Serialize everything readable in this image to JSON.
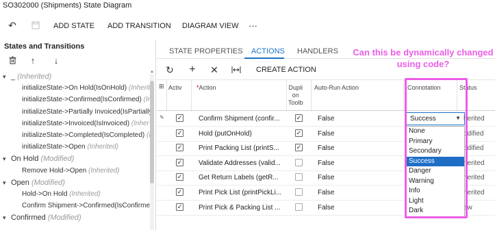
{
  "window": {
    "title": "SO302000 (Shipments) State Diagram"
  },
  "toolbar": {
    "undo_icon": "undo-icon",
    "save_icon": "save-icon",
    "add_state": "ADD STATE",
    "add_transition": "ADD TRANSITION",
    "diagram_view": "DIAGRAM VIEW",
    "more": "···"
  },
  "left": {
    "title": "States and Transitions",
    "tree": [
      {
        "kind": "root",
        "caret": "▾",
        "name": "_",
        "tag": "(Inherited)"
      },
      {
        "kind": "child",
        "name": "initializeState->On Hold(IsOnHold)",
        "tag": "(Inherit"
      },
      {
        "kind": "child",
        "name": "initializeState->Confirmed(IsConfirmed)",
        "tag": "(In"
      },
      {
        "kind": "child",
        "name": "initializeState->Partially Invoiced(IsPartially",
        "tag": ""
      },
      {
        "kind": "child",
        "name": "initializeState->Invoiced(IsInvoiced)",
        "tag": "(Inher"
      },
      {
        "kind": "child",
        "name": "initializeState->Completed(IsCompleted)",
        "tag": "(I"
      },
      {
        "kind": "child",
        "name": "initializeState->Open",
        "tag": "(Inherited)"
      },
      {
        "kind": "root",
        "caret": "▾",
        "name": "On Hold",
        "tag": "(Modified)"
      },
      {
        "kind": "child",
        "name": "Remove Hold->Open",
        "tag": "(Inherited)"
      },
      {
        "kind": "root",
        "caret": "▾",
        "name": "Open",
        "tag": "(Modified)"
      },
      {
        "kind": "child",
        "name": "Hold->On Hold",
        "tag": "(Inherited)"
      },
      {
        "kind": "child",
        "name": "Confirm Shipment->Confirmed(IsConfirme",
        "tag": ""
      },
      {
        "kind": "root",
        "caret": "▾",
        "name": "Confirmed",
        "tag": "(Modified)"
      }
    ]
  },
  "tabs": [
    {
      "label": "STATE PROPERTIES"
    },
    {
      "label": "ACTIONS"
    },
    {
      "label": "HANDLERS"
    }
  ],
  "grid": {
    "create_action": "CREATE ACTION",
    "headers": {
      "active": "Activ",
      "action": "Action",
      "dupl": "Dupli\non\nToolb",
      "autorun": "Auto-Run Action",
      "connotation": "Connotation",
      "status": "Status"
    },
    "rows": [
      {
        "active": true,
        "action": "Confirm Shipment (confir...",
        "dupl": true,
        "autorun": "False",
        "connotation": "Success",
        "status": "herited"
      },
      {
        "active": true,
        "action": "Hold (putOnHold)",
        "dupl": true,
        "autorun": "False",
        "connotation": "",
        "status": "odified"
      },
      {
        "active": true,
        "action": "Print Packing List (printS...",
        "dupl": true,
        "autorun": "False",
        "connotation": "",
        "status": "odified"
      },
      {
        "active": true,
        "action": "Validate Addresses (valid...",
        "dupl": false,
        "autorun": "False",
        "connotation": "",
        "status": "herited"
      },
      {
        "active": true,
        "action": "Get Return Labels (getR...",
        "dupl": false,
        "autorun": "False",
        "connotation": "",
        "status": "herited"
      },
      {
        "active": true,
        "action": "Print Pick List (printPickLi...",
        "dupl": false,
        "autorun": "False",
        "connotation": "",
        "status": "herited"
      },
      {
        "active": true,
        "action": "Print Pick & Packing List ...",
        "dupl": false,
        "autorun": "False",
        "connotation": "",
        "status": "ew"
      }
    ]
  },
  "dropdown": {
    "selected": "Success",
    "options": [
      "None",
      "Primary",
      "Secondary",
      "Success",
      "Danger",
      "Warning",
      "Info",
      "Light",
      "Dark"
    ]
  },
  "annotation": {
    "text": "Can this be dynamically changed using code?",
    "color": "#ec5de8"
  },
  "colors": {
    "accent": "#1a73c8",
    "selected_bg": "#1f6ec6",
    "annotation": "#ec5de8"
  }
}
